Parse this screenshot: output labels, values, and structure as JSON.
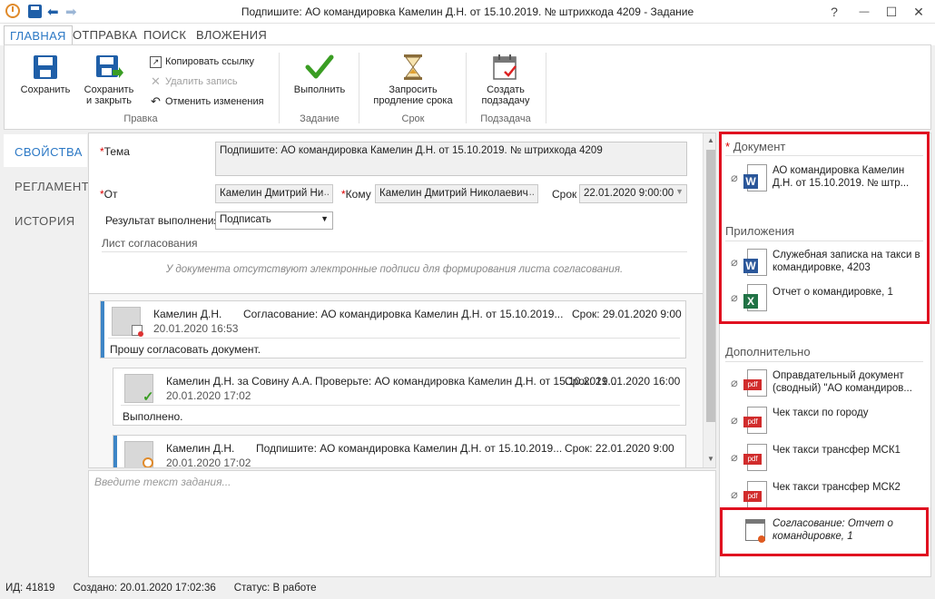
{
  "window": {
    "title": "Подпишите: АО командировка Камелин Д.Н. от 15.10.2019. № штрихкода 4209 - Задание",
    "help": "?",
    "minimize": "—",
    "maximize": "☐",
    "close": "✕"
  },
  "tabs": [
    "ГЛАВНАЯ",
    "ОТПРАВКА",
    "ПОИСК",
    "ВЛОЖЕНИЯ"
  ],
  "ribbon": {
    "save": "Сохранить",
    "save_close_1": "Сохранить",
    "save_close_2": "и закрыть",
    "copy_link": "Копировать ссылку",
    "delete_record": "Удалить запись",
    "undo_changes": "Отменить изменения",
    "group_edit": "Правка",
    "execute": "Выполнить",
    "group_task": "Задание",
    "request_ext_1": "Запросить",
    "request_ext_2": "продление срока",
    "group_deadline": "Срок",
    "create_sub_1": "Создать",
    "create_sub_2": "подзадачу",
    "group_subtask": "Подзадача"
  },
  "nav": [
    "СВОЙСТВА",
    "РЕГЛАМЕНТ",
    "ИСТОРИЯ"
  ],
  "form": {
    "subject_label": "Тема",
    "subject_value": "Подпишите: АО командировка Камелин Д.Н. от 15.10.2019. № штрихкода 4209",
    "from_label": "От",
    "from_value": "Камелин Дмитрий Ни",
    "to_label": "Кому",
    "to_value": "Камелин Дмитрий Николаевич",
    "deadline_label": "Срок",
    "deadline_value": "22.01.2020 9:00:00",
    "result_label": "Результат выполнения",
    "result_value": "Подписать",
    "approval_sheet": "Лист согласования",
    "no_signatures": "У документа отсутствуют электронные подписи для формирования листа согласования.",
    "ellipsis": "..."
  },
  "messages": [
    {
      "author": "Камелин Д.Н.",
      "subject": "Согласование: АО командировка Камелин Д.Н. от 15.10.2019...",
      "deadline": "Срок: 29.01.2020 9:00",
      "date": "20.01.2020 16:53",
      "text": "Прошу согласовать документ."
    },
    {
      "author": "Камелин Д.Н. за Совину А.А.",
      "subject": "Проверьте: АО командировка Камелин Д.Н. от 15.10.2019...",
      "deadline": "Срок: 21.01.2020 16:00",
      "date": "20.01.2020 17:02",
      "text": "Выполнено."
    },
    {
      "author": "Камелин Д.Н.",
      "subject": "Подпишите: АО командировка Камелин Д.Н. от 15.10.2019...",
      "deadline": "Срок: 22.01.2020 9:00",
      "date": "20.01.2020 17:02"
    }
  ],
  "task_input_placeholder": "Введите текст задания...",
  "right": {
    "document_title": "Документ",
    "document_file": "АО командировка Камелин Д.Н. от 15.10.2019. № штр...",
    "attachments_title": "Приложения",
    "attach1": "Служебная записка на такси в командировке,  4203",
    "attach2": "Отчет о командировке,  1",
    "extra_title": "Дополнительно",
    "extra1": "Оправдательный документ (сводный) \"АО командиров...",
    "extra2": "Чек такси по городу",
    "extra3": "Чек такси трансфер МСК1",
    "extra4": "Чек такси трансфер МСК2",
    "extra5": "Согласование: Отчет о командировке, 1",
    "word_badge": "W",
    "excel_badge": "X",
    "pdf_badge": "pdf"
  },
  "status": {
    "id": "ИД: 41819",
    "created": "Создано: 20.01.2020 17:02:36",
    "state": "Статус: В работе"
  },
  "colors": {
    "accent": "#2b78c5",
    "highlight_box": "#e01020",
    "check_green": "#3a9d23"
  }
}
